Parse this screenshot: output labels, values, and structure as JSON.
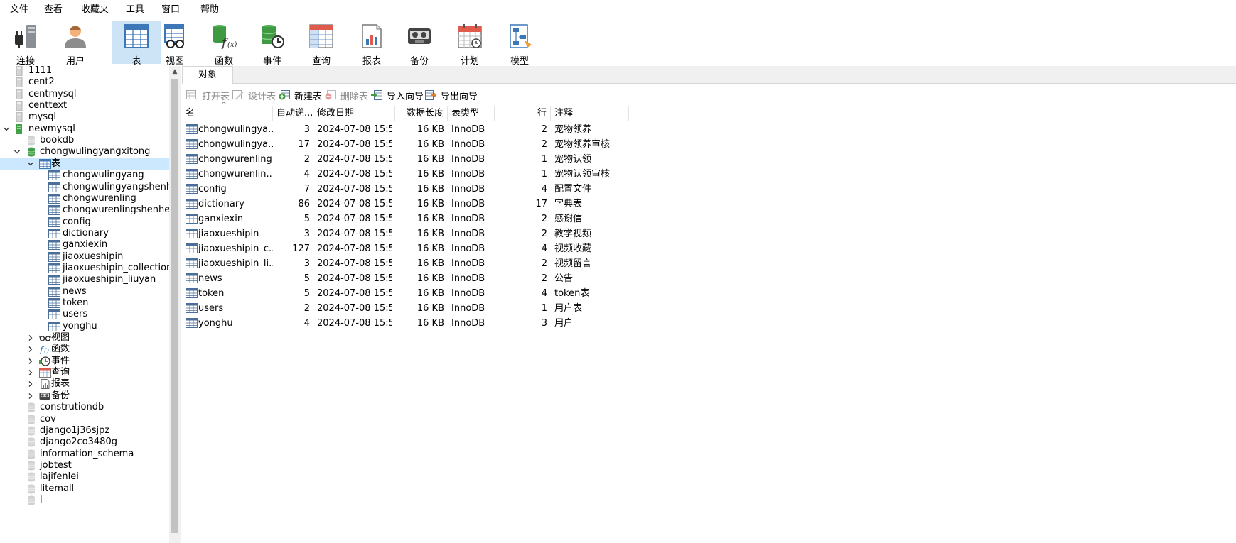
{
  "menu": [
    "文件",
    "查看",
    "收藏夹",
    "工具",
    "窗口",
    "帮助"
  ],
  "toolbar": [
    {
      "label": "连接",
      "icon": "plug-icon",
      "active": false
    },
    {
      "label": "用户",
      "icon": "user-icon",
      "active": false
    },
    {
      "label": "表",
      "icon": "table-icon",
      "active": true
    },
    {
      "label": "视图",
      "icon": "view-icon",
      "active": false
    },
    {
      "label": "函数",
      "icon": "function-icon",
      "active": false
    },
    {
      "label": "事件",
      "icon": "event-icon",
      "active": false
    },
    {
      "label": "查询",
      "icon": "query-icon",
      "active": false
    },
    {
      "label": "报表",
      "icon": "report-icon",
      "active": false
    },
    {
      "label": "备份",
      "icon": "backup-icon",
      "active": false
    },
    {
      "label": "计划",
      "icon": "calendar-icon",
      "active": false
    },
    {
      "label": "模型",
      "icon": "model-icon",
      "active": false
    }
  ],
  "tree": [
    {
      "label": "1111",
      "level": 0,
      "type": "conn-gray",
      "chev": ""
    },
    {
      "label": "cent2",
      "level": 0,
      "type": "conn-gray",
      "chev": ""
    },
    {
      "label": "centmysql",
      "level": 0,
      "type": "conn-gray",
      "chev": ""
    },
    {
      "label": "centtext",
      "level": 0,
      "type": "conn-gray",
      "chev": ""
    },
    {
      "label": "mysql",
      "level": 0,
      "type": "conn-gray",
      "chev": ""
    },
    {
      "label": "newmysql",
      "level": 0,
      "type": "conn-green",
      "chev": "down"
    },
    {
      "label": "bookdb",
      "level": 1,
      "type": "db-gray",
      "chev": ""
    },
    {
      "label": "chongwulingyangxitong",
      "level": 1,
      "type": "db-green",
      "chev": "down"
    },
    {
      "label": "表",
      "level": 2,
      "type": "table-folder",
      "chev": "down",
      "selected": true
    },
    {
      "label": "chongwulingyang",
      "level": 3,
      "type": "table",
      "chev": ""
    },
    {
      "label": "chongwulingyangshenhe",
      "level": 3,
      "type": "table",
      "chev": ""
    },
    {
      "label": "chongwurenling",
      "level": 3,
      "type": "table",
      "chev": ""
    },
    {
      "label": "chongwurenlingshenhe",
      "level": 3,
      "type": "table",
      "chev": ""
    },
    {
      "label": "config",
      "level": 3,
      "type": "table",
      "chev": ""
    },
    {
      "label": "dictionary",
      "level": 3,
      "type": "table",
      "chev": ""
    },
    {
      "label": "ganxiexin",
      "level": 3,
      "type": "table",
      "chev": ""
    },
    {
      "label": "jiaoxueshipin",
      "level": 3,
      "type": "table",
      "chev": ""
    },
    {
      "label": "jiaoxueshipin_collection",
      "level": 3,
      "type": "table",
      "chev": ""
    },
    {
      "label": "jiaoxueshipin_liuyan",
      "level": 3,
      "type": "table",
      "chev": ""
    },
    {
      "label": "news",
      "level": 3,
      "type": "table",
      "chev": ""
    },
    {
      "label": "token",
      "level": 3,
      "type": "table",
      "chev": ""
    },
    {
      "label": "users",
      "level": 3,
      "type": "table",
      "chev": ""
    },
    {
      "label": "yonghu",
      "level": 3,
      "type": "table",
      "chev": ""
    },
    {
      "label": "视图",
      "level": 2,
      "type": "view",
      "chev": "right"
    },
    {
      "label": "函数",
      "level": 2,
      "type": "function",
      "chev": "right"
    },
    {
      "label": "事件",
      "level": 2,
      "type": "event",
      "chev": "right"
    },
    {
      "label": "查询",
      "level": 2,
      "type": "query",
      "chev": "right"
    },
    {
      "label": "报表",
      "level": 2,
      "type": "report",
      "chev": "right"
    },
    {
      "label": "备份",
      "level": 2,
      "type": "backup",
      "chev": "right"
    },
    {
      "label": "construtiondb",
      "level": 1,
      "type": "db-gray",
      "chev": ""
    },
    {
      "label": "cov",
      "level": 1,
      "type": "db-gray",
      "chev": ""
    },
    {
      "label": "django1j36sjpz",
      "level": 1,
      "type": "db-gray",
      "chev": ""
    },
    {
      "label": "django2co3480g",
      "level": 1,
      "type": "db-gray",
      "chev": ""
    },
    {
      "label": "information_schema",
      "level": 1,
      "type": "db-gray",
      "chev": ""
    },
    {
      "label": "jobtest",
      "level": 1,
      "type": "db-gray",
      "chev": ""
    },
    {
      "label": "lajifenlei",
      "level": 1,
      "type": "db-gray",
      "chev": ""
    },
    {
      "label": "litemall",
      "level": 1,
      "type": "db-gray",
      "chev": ""
    },
    {
      "label": "l",
      "level": 1,
      "type": "db-gray",
      "chev": ""
    }
  ],
  "tab": {
    "label": "对象"
  },
  "actions": [
    {
      "label": "打开表",
      "disabled": true,
      "icon": "open-table-icon"
    },
    {
      "label": "设计表",
      "disabled": true,
      "icon": "design-table-icon"
    },
    {
      "label": "新建表",
      "disabled": false,
      "icon": "new-table-icon"
    },
    {
      "label": "删除表",
      "disabled": true,
      "icon": "delete-table-icon"
    },
    {
      "label": "导入向导",
      "disabled": false,
      "icon": "import-wizard-icon"
    },
    {
      "label": "导出向导",
      "disabled": false,
      "icon": "export-wizard-icon"
    }
  ],
  "columns": [
    "名",
    "自动递...",
    "修改日期",
    "数据长度",
    "表类型",
    "行",
    "注释"
  ],
  "rows": [
    {
      "name": "chongwulingya...",
      "auto": "3",
      "date": "2024-07-08 15:5...",
      "size": "16 KB",
      "engine": "InnoDB",
      "rows": "2",
      "comment": "宠物领养"
    },
    {
      "name": "chongwulingya...",
      "auto": "17",
      "date": "2024-07-08 15:5...",
      "size": "16 KB",
      "engine": "InnoDB",
      "rows": "2",
      "comment": "宠物领养审核"
    },
    {
      "name": "chongwurenling",
      "auto": "2",
      "date": "2024-07-08 15:5...",
      "size": "16 KB",
      "engine": "InnoDB",
      "rows": "1",
      "comment": "宠物认领"
    },
    {
      "name": "chongwurenlin...",
      "auto": "4",
      "date": "2024-07-08 15:5...",
      "size": "16 KB",
      "engine": "InnoDB",
      "rows": "1",
      "comment": "宠物认领审核"
    },
    {
      "name": "config",
      "auto": "7",
      "date": "2024-07-08 15:5...",
      "size": "16 KB",
      "engine": "InnoDB",
      "rows": "4",
      "comment": "配置文件"
    },
    {
      "name": "dictionary",
      "auto": "86",
      "date": "2024-07-08 15:5...",
      "size": "16 KB",
      "engine": "InnoDB",
      "rows": "17",
      "comment": "字典表"
    },
    {
      "name": "ganxiexin",
      "auto": "5",
      "date": "2024-07-08 15:5...",
      "size": "16 KB",
      "engine": "InnoDB",
      "rows": "2",
      "comment": "感谢信"
    },
    {
      "name": "jiaoxueshipin",
      "auto": "3",
      "date": "2024-07-08 15:5...",
      "size": "16 KB",
      "engine": "InnoDB",
      "rows": "2",
      "comment": "教学视频"
    },
    {
      "name": "jiaoxueshipin_c...",
      "auto": "127",
      "date": "2024-07-08 15:5...",
      "size": "16 KB",
      "engine": "InnoDB",
      "rows": "4",
      "comment": "视频收藏"
    },
    {
      "name": "jiaoxueshipin_li...",
      "auto": "3",
      "date": "2024-07-08 15:5...",
      "size": "16 KB",
      "engine": "InnoDB",
      "rows": "2",
      "comment": "视频留言"
    },
    {
      "name": "news",
      "auto": "5",
      "date": "2024-07-08 15:5...",
      "size": "16 KB",
      "engine": "InnoDB",
      "rows": "2",
      "comment": "公告"
    },
    {
      "name": "token",
      "auto": "5",
      "date": "2024-07-08 15:5...",
      "size": "16 KB",
      "engine": "InnoDB",
      "rows": "4",
      "comment": "token表"
    },
    {
      "name": "users",
      "auto": "2",
      "date": "2024-07-08 15:5...",
      "size": "16 KB",
      "engine": "InnoDB",
      "rows": "1",
      "comment": "用户表"
    },
    {
      "name": "yonghu",
      "auto": "4",
      "date": "2024-07-08 15:5...",
      "size": "16 KB",
      "engine": "InnoDB",
      "rows": "3",
      "comment": "用户"
    }
  ]
}
